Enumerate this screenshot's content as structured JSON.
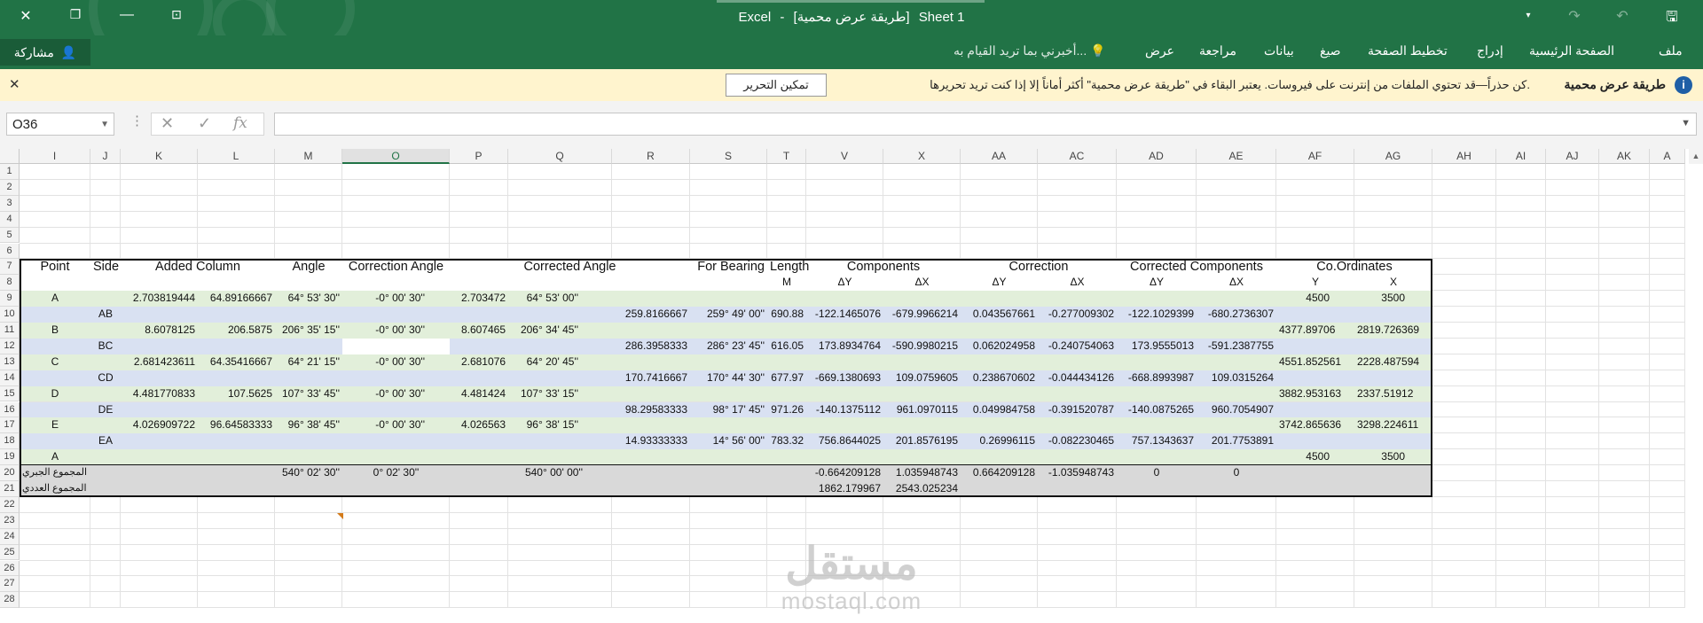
{
  "window": {
    "app": "Excel",
    "separator": "-",
    "file_title": "[طريقة عرض محمية]",
    "sheet": "Sheet 1"
  },
  "ribbon": {
    "tabs": [
      "ملف",
      "الصفحة الرئيسية",
      "إدراج",
      "تخطيط الصفحة",
      "صيغ",
      "بيانات",
      "مراجعة",
      "عرض"
    ],
    "tell_me": "أخبرني بما تريد القيام به...",
    "share": "مشاركة"
  },
  "message_bar": {
    "title": "طريقة عرض محمية",
    "body": "كن حذراً—قد تحتوي الملفات من إنترنت على فيروسات. يعتبر البقاء في \"طريقة عرض محمية\" أكثر أماناً إلا إذا كنت تريد تحريرها.",
    "button": "تمكين التحرير"
  },
  "formula_bar": {
    "name_box": "O36",
    "cancel_glyph": "✕",
    "enter_glyph": "✓",
    "fx": "fx",
    "formula": ""
  },
  "sheet": {
    "columns": [
      "I",
      "J",
      "K",
      "L",
      "M",
      "O",
      "P",
      "Q",
      "R",
      "S",
      "T",
      "V",
      "X",
      "AA",
      "AC",
      "AD",
      "AE",
      "AF",
      "AG",
      "AH",
      "AI",
      "AJ",
      "AK",
      "A"
    ],
    "selected_column": "O",
    "rows": [
      "1",
      "2",
      "3",
      "4",
      "5",
      "6",
      "7",
      "8",
      "9",
      "10",
      "11",
      "12",
      "13",
      "14",
      "15",
      "16",
      "17",
      "18",
      "19",
      "20",
      "21",
      "22",
      "23",
      "24",
      "25",
      "26",
      "27",
      "28"
    ],
    "table": {
      "header": [
        "Point",
        "Side",
        "Added Column",
        "Angle",
        "Correction Angle",
        "Corrected Angle",
        "For Bearing",
        "Length",
        "Components",
        "Correction",
        "Corrected Components",
        "Co.Ordinates"
      ],
      "subheader": {
        "length": "M",
        "comp_dy": "ΔY",
        "comp_dx": "ΔX",
        "corr_dy": "ΔY",
        "corr_dx": "ΔX",
        "cc_dy": "ΔY",
        "cc_dx": "ΔX",
        "y": "Y",
        "x": "X"
      },
      "rows": [
        {
          "I": "A",
          "K": "2.703819444",
          "L": "64.89166667",
          "M": "64° 53' 30''",
          "O": "-0° 00' 30''",
          "P": "2.703472",
          "Q": "64° 53' 00''",
          "AF": "4500",
          "AG": "3500"
        },
        {
          "J": "AB",
          "R": "259.8166667",
          "S": "259° 49' 00''",
          "T": "690.88",
          "V": "-122.1465076",
          "X": "-679.9966214",
          "AA": "0.043567661",
          "AC": "-0.277009302",
          "AD": "-122.1029399",
          "AE": "-680.2736307"
        },
        {
          "I": "B",
          "K": "8.6078125",
          "L": "206.5875",
          "M": "206° 35' 15''",
          "O": "-0° 00' 30''",
          "P": "8.607465",
          "Q": "206° 34' 45''",
          "AF": "4377.89706",
          "AG": "2819.726369"
        },
        {
          "J": "BC",
          "R": "286.3958333",
          "S": "286° 23' 45''",
          "T": "616.05",
          "V": "173.8934764",
          "X": "-590.9980215",
          "AA": "0.062024958",
          "AC": "-0.240754063",
          "AD": "173.9555013",
          "AE": "-591.2387755"
        },
        {
          "I": "C",
          "K": "2.681423611",
          "L": "64.35416667",
          "M": "64° 21' 15''",
          "O": "-0° 00' 30''",
          "P": "2.681076",
          "Q": "64° 20' 45''",
          "AF": "4551.852561",
          "AG": "2228.487594"
        },
        {
          "J": "CD",
          "R": "170.7416667",
          "S": "170° 44' 30''",
          "T": "677.97",
          "V": "-669.1380693",
          "X": "109.0759605",
          "AA": "0.238670602",
          "AC": "-0.044434126",
          "AD": "-668.8993987",
          "AE": "109.0315264"
        },
        {
          "I": "D",
          "K": "4.481770833",
          "L": "107.5625",
          "M": "107° 33' 45''",
          "O": "-0° 00' 30''",
          "P": "4.481424",
          "Q": "107° 33' 15''",
          "AF": "3882.953163",
          "AG": "2337.51912"
        },
        {
          "J": "DE",
          "R": "98.29583333",
          "S": "98° 17' 45''",
          "T": "971.26",
          "V": "-140.1375112",
          "X": "961.0970115",
          "AA": "0.049984758",
          "AC": "-0.391520787",
          "AD": "-140.0875265",
          "AE": "960.7054907"
        },
        {
          "I": "E",
          "K": "4.026909722",
          "L": "96.64583333",
          "M": "96° 38' 45''",
          "O": "-0° 00' 30''",
          "P": "4.026563",
          "Q": "96° 38' 15''",
          "AF": "3742.865636",
          "AG": "3298.224611"
        },
        {
          "J": "EA",
          "R": "14.93333333",
          "S": "14° 56' 00''",
          "T": "783.32",
          "V": "756.8644025",
          "X": "201.8576195",
          "AA": "0.26996115",
          "AC": "-0.082230465",
          "AD": "757.1343637",
          "AE": "201.7753891"
        },
        {
          "I": "A",
          "AF": "4500",
          "AG": "3500"
        }
      ],
      "sum_algebraic": {
        "label": "المجموع الجبري",
        "M": "540° 02' 30''",
        "O": "0° 02' 30''",
        "Q": "540° 00' 00''",
        "V": "-0.664209128",
        "X": "1.035948743",
        "AA": "0.664209128",
        "AC": "-1.035948743",
        "AD": "0",
        "AE": "0"
      },
      "sum_numeric": {
        "label": "المجموع العددي",
        "V": "1862.179967",
        "X": "2543.025234"
      }
    }
  },
  "watermark": {
    "brand": "مستقل",
    "site": "mostaql.com"
  },
  "colors": {
    "excel_green": "#217346",
    "band_green": "#e2efda",
    "band_blue": "#d9e1f2",
    "gray": "#d9d9d9",
    "warn": "#fff4ce"
  }
}
